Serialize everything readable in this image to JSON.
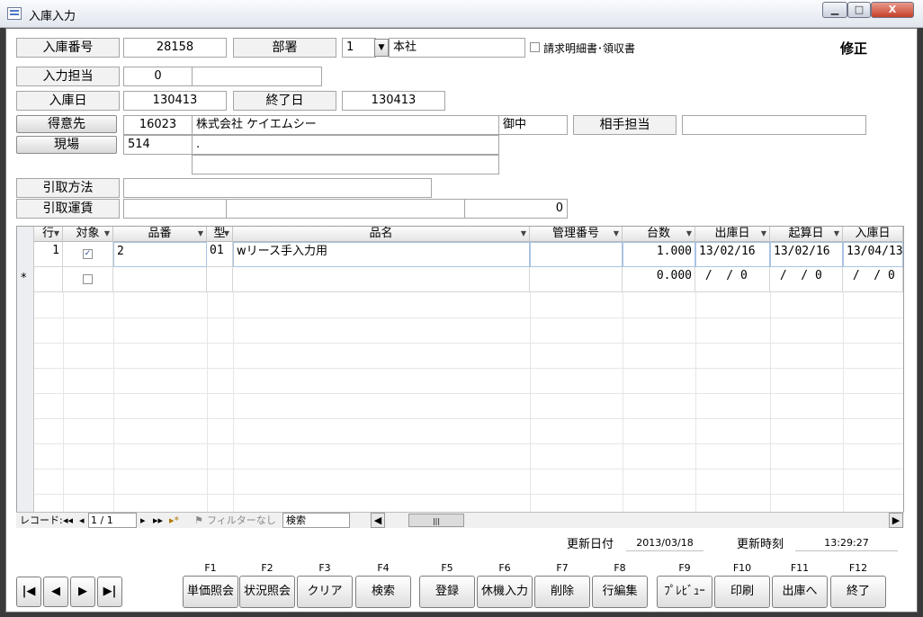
{
  "window": {
    "title": "入庫入力",
    "min": "▁",
    "max": "□",
    "close": "X"
  },
  "form": {
    "labels": {
      "receipt_no": "入庫番号",
      "department": "部署",
      "input_staff": "入力担当",
      "receipt_date": "入庫日",
      "end_date": "終了日",
      "customer": "得意先",
      "site": "現場",
      "counterpart": "相手担当",
      "pickup_method": "引取方法",
      "pickup_fare": "引取運賃"
    },
    "values": {
      "receipt_no": "28158",
      "department_code": "1",
      "department_name": "本社",
      "invoice_label": "請求明細書･領収書",
      "mode": "修正",
      "input_staff_code": "0",
      "input_staff_name": "",
      "receipt_date": "130413",
      "end_date": "130413",
      "customer_code": "16023",
      "customer_name": "株式会社  ケイエムシー",
      "honorific": "御中",
      "counterpart_name": "",
      "site_code": "514",
      "site_line1": ".",
      "site_line2": "",
      "pickup_method": "",
      "pickup_fare_a": "",
      "pickup_fare_b": "",
      "pickup_fare_amount": "0"
    }
  },
  "grid": {
    "headers": {
      "row": "行",
      "target": "対象",
      "item_no": "品番",
      "type": "型",
      "item_name": "品名",
      "mgmt_no": "管理番号",
      "qty": "台数",
      "ship_date": "出庫日",
      "start_date": "起算日",
      "recv_date": "入庫日"
    },
    "rows": [
      {
        "row": "1",
        "target": true,
        "item_no": "2",
        "type": "01",
        "item_name": "wリース手入力用",
        "mgmt_no": "",
        "qty": "1.000",
        "ship_date": "13/02/16",
        "start_date": "13/02/16",
        "recv_date": "13/04/13"
      }
    ],
    "new_row": {
      "marker": "*",
      "qty": "0.000",
      "ship_date": " /  / 0",
      "start_date": " /  / 0",
      "recv_date": " /  / 0"
    }
  },
  "nav": {
    "record_label": "レコード:",
    "first": "◂◂",
    "prev": "◂",
    "position": "1 / 1",
    "next": "▸",
    "last": "▸▸",
    "new": "▸*",
    "filter": "フィルターなし",
    "search": "検索"
  },
  "status": {
    "updated_date_label": "更新日付",
    "updated_date": "2013/03/18",
    "updated_time_label": "更新時刻",
    "updated_time": "13:29:27"
  },
  "record_nav_buttons": {
    "first": "|◀",
    "prev": "◀",
    "next": "▶",
    "last": "▶|"
  },
  "function_keys": [
    {
      "key": "F1",
      "label": "単価照会"
    },
    {
      "key": "F2",
      "label": "状況照会"
    },
    {
      "key": "F3",
      "label": "クリア"
    },
    {
      "key": "F4",
      "label": "検索"
    },
    {
      "key": "F5",
      "label": "登録"
    },
    {
      "key": "F6",
      "label": "休機入力"
    },
    {
      "key": "F7",
      "label": "削除"
    },
    {
      "key": "F8",
      "label": "行編集"
    },
    {
      "key": "F9",
      "label": "ﾌﾟﾚﾋﾞｭｰ"
    },
    {
      "key": "F10",
      "label": "印刷"
    },
    {
      "key": "F11",
      "label": "出庫へ"
    },
    {
      "key": "F12",
      "label": "終了"
    }
  ]
}
